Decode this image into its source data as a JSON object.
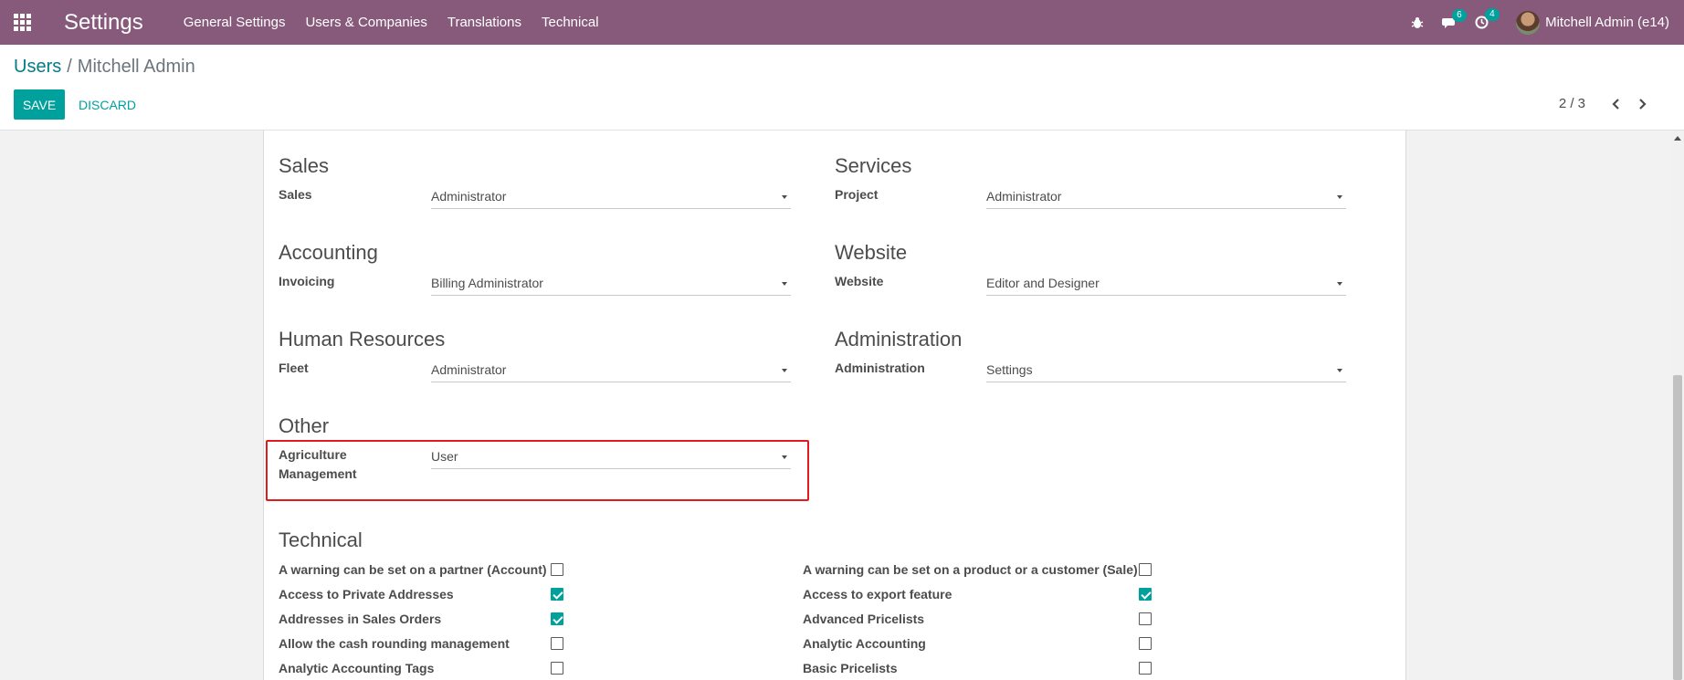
{
  "navbar": {
    "app_title": "Settings",
    "menu": [
      "General Settings",
      "Users & Companies",
      "Translations",
      "Technical"
    ],
    "messages_count": "6",
    "activities_count": "4",
    "user_name": "Mitchell Admin (e14)"
  },
  "breadcrumb": {
    "parent": "Users",
    "separator": "/",
    "current": "Mitchell Admin"
  },
  "actions": {
    "save_label": "SAVE",
    "discard_label": "DISCARD"
  },
  "pager": {
    "value": "2 / 3"
  },
  "groups": {
    "sales": {
      "title": "Sales",
      "label": "Sales",
      "value": "Administrator"
    },
    "services": {
      "title": "Services",
      "label": "Project",
      "value": "Administrator"
    },
    "accounting": {
      "title": "Accounting",
      "label": "Invoicing",
      "value": "Billing Administrator"
    },
    "website": {
      "title": "Website",
      "label": "Website",
      "value": "Editor and Designer"
    },
    "hr": {
      "title": "Human Resources",
      "label": "Fleet",
      "value": "Administrator"
    },
    "administration": {
      "title": "Administration",
      "label": "Administration",
      "value": "Settings"
    },
    "other": {
      "title": "Other",
      "label_line1": "Agriculture",
      "label_line2": "Management",
      "value": "User"
    }
  },
  "technical": {
    "title": "Technical",
    "left": [
      {
        "label": "A warning can be set on a partner (Account)",
        "checked": false
      },
      {
        "label": "Access to Private Addresses",
        "checked": true
      },
      {
        "label": "Addresses in Sales Orders",
        "checked": true
      },
      {
        "label": "Allow the cash rounding management",
        "checked": false
      },
      {
        "label": "Analytic Accounting Tags",
        "checked": false
      }
    ],
    "right": [
      {
        "label": "A warning can be set on a product or a customer (Sale)",
        "checked": false
      },
      {
        "label": "Access to export feature",
        "checked": true
      },
      {
        "label": "Advanced Pricelists",
        "checked": false
      },
      {
        "label": "Analytic Accounting",
        "checked": false
      },
      {
        "label": "Basic Pricelists",
        "checked": false
      }
    ]
  },
  "colors": {
    "navbar": "#875a7b",
    "accent": "#00a09d",
    "highlight": "#e21c1c"
  },
  "icons": {
    "apps": "apps-grid-icon",
    "bug": "bug-icon",
    "chat": "chat-icon",
    "activity": "clock-icon"
  }
}
